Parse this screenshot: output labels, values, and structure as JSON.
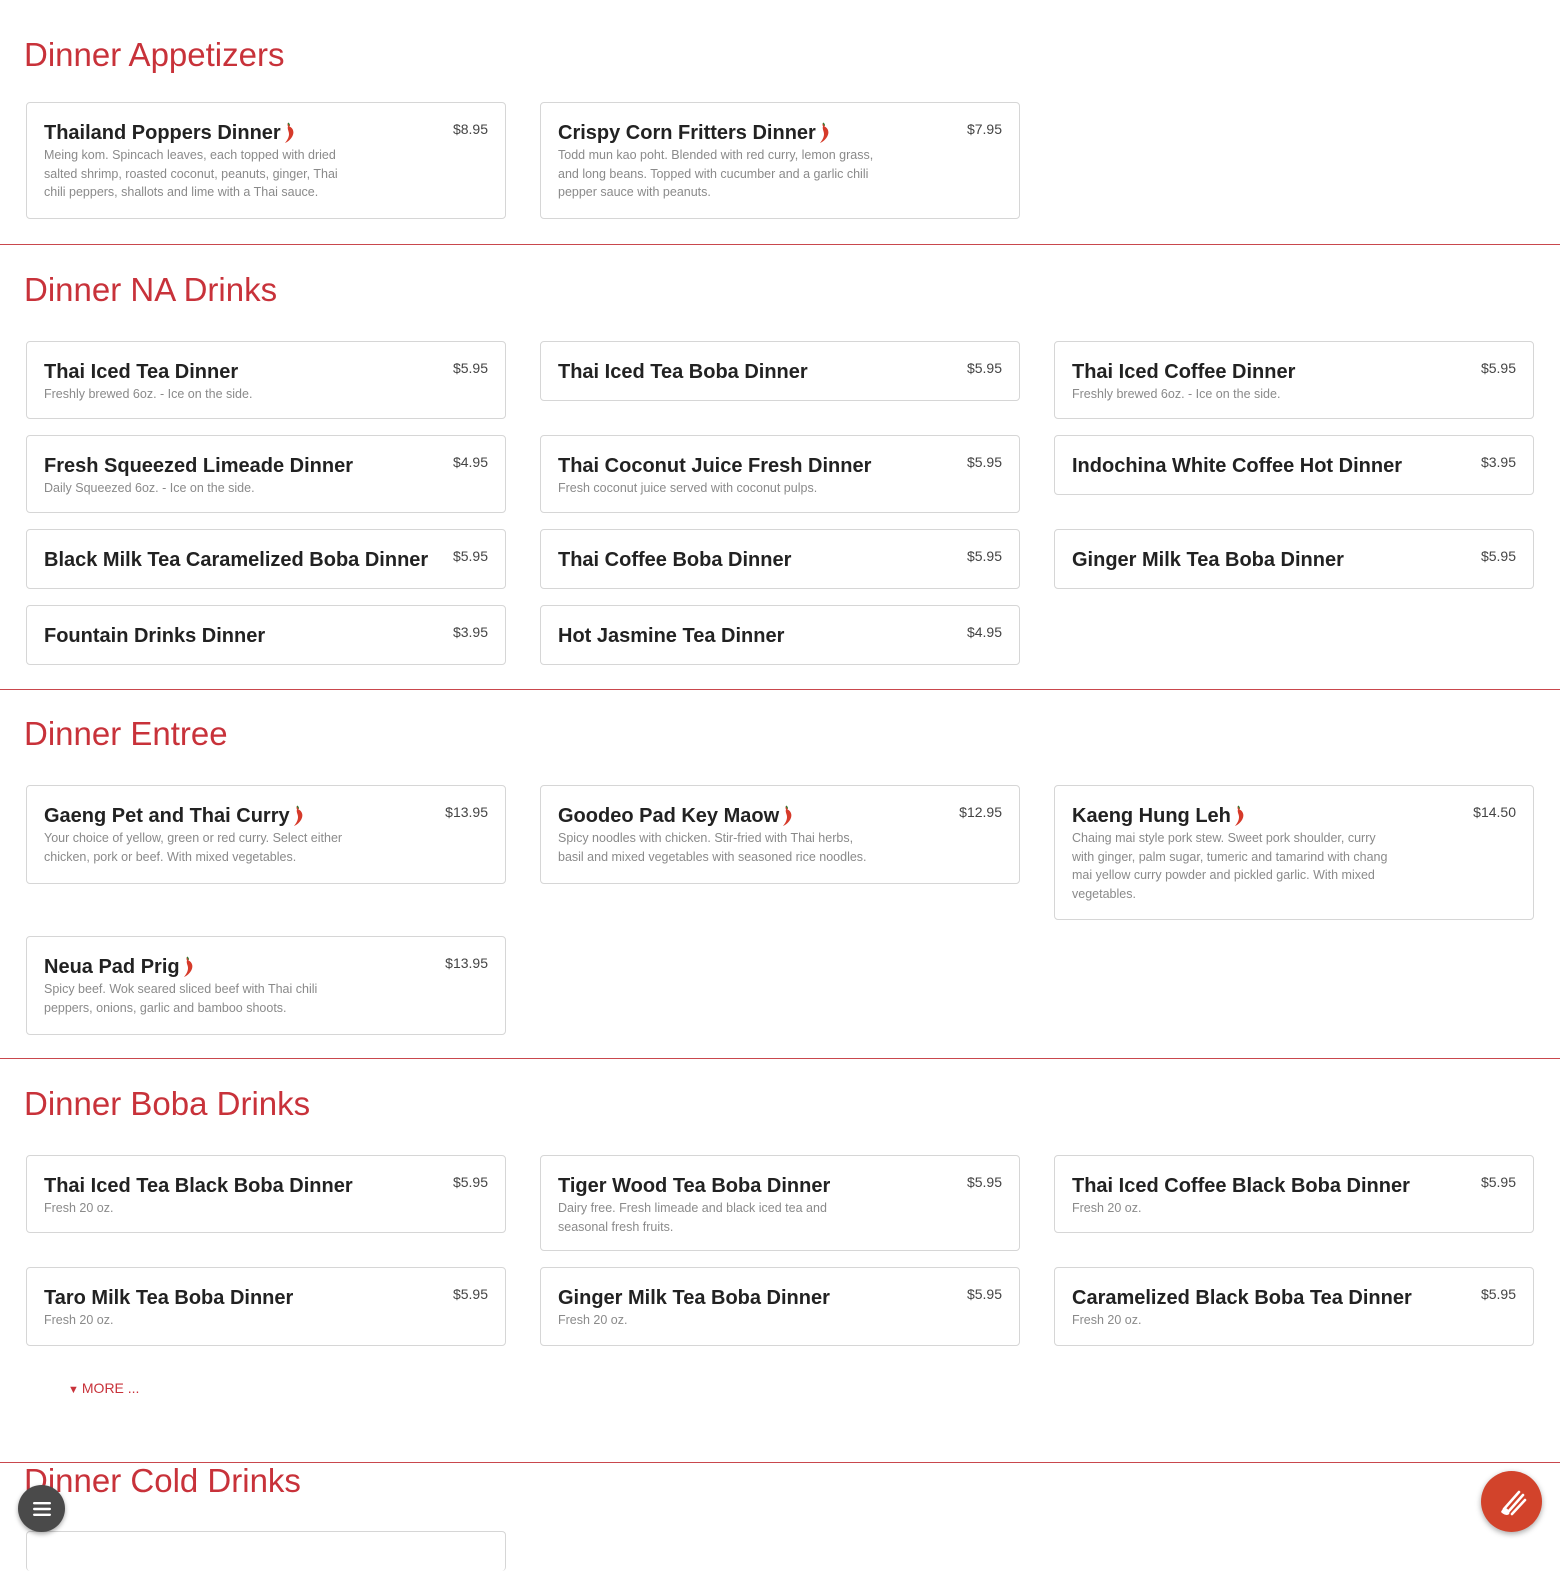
{
  "sections": [
    {
      "title": "Dinner Appetizers",
      "items": [
        {
          "name": "Thailand Poppers Dinner",
          "price": "$8.95",
          "spicy": true,
          "desc": "Meing kom. Spincach leaves, each topped with dried salted shrimp, roasted coconut, peanuts, ginger, Thai chili peppers, shallots and lime with a Thai sauce."
        },
        {
          "name": "Crispy Corn Fritters Dinner",
          "price": "$7.95",
          "spicy": true,
          "desc": "Todd mun kao poht. Blended with red curry, lemon grass, and long beans. Topped with cucumber and a garlic chili pepper sauce with peanuts."
        }
      ]
    },
    {
      "title": "Dinner NA Drinks",
      "items": [
        {
          "name": "Thai Iced Tea Dinner",
          "price": "$5.95",
          "spicy": false,
          "desc": "Freshly brewed 6oz. - Ice on the side."
        },
        {
          "name": "Thai Iced Tea Boba Dinner",
          "price": "$5.95",
          "spicy": false,
          "desc": ""
        },
        {
          "name": "Thai Iced Coffee Dinner",
          "price": "$5.95",
          "spicy": false,
          "desc": "Freshly brewed 6oz. - Ice on the side."
        },
        {
          "name": "Fresh Squeezed Limeade Dinner",
          "price": "$4.95",
          "spicy": false,
          "desc": "Daily Squeezed 6oz. - Ice on the side."
        },
        {
          "name": "Thai Coconut Juice Fresh Dinner",
          "price": "$5.95",
          "spicy": false,
          "desc": "Fresh coconut juice served with coconut pulps."
        },
        {
          "name": "Indochina White Coffee Hot Dinner",
          "price": "$3.95",
          "spicy": false,
          "desc": ""
        },
        {
          "name": "Black Milk Tea Caramelized Boba Dinner",
          "price": "$5.95",
          "spicy": false,
          "desc": ""
        },
        {
          "name": "Thai Coffee Boba Dinner",
          "price": "$5.95",
          "spicy": false,
          "desc": ""
        },
        {
          "name": "Ginger Milk Tea Boba Dinner",
          "price": "$5.95",
          "spicy": false,
          "desc": ""
        },
        {
          "name": "Fountain Drinks Dinner",
          "price": "$3.95",
          "spicy": false,
          "desc": ""
        },
        {
          "name": "Hot Jasmine Tea Dinner",
          "price": "$4.95",
          "spicy": false,
          "desc": ""
        }
      ]
    },
    {
      "title": "Dinner Entree",
      "items": [
        {
          "name": "Gaeng Pet and Thai Curry",
          "price": "$13.95",
          "spicy": true,
          "desc": "Your choice of yellow, green or red curry. Select either chicken, pork or beef. With mixed vegetables."
        },
        {
          "name": "Goodeo Pad Key Maow",
          "price": "$12.95",
          "spicy": true,
          "desc": "Spicy noodles with chicken. Stir-fried with Thai herbs, basil and mixed vegetables with seasoned rice noodles."
        },
        {
          "name": "Kaeng Hung Leh",
          "price": "$14.50",
          "spicy": true,
          "desc": "Chaing mai style pork stew. Sweet pork shoulder, curry with ginger, palm sugar, tumeric and tamarind with chang mai yellow curry powder and pickled garlic. With mixed vegetables."
        },
        {
          "name": "Neua Pad Prig",
          "price": "$13.95",
          "spicy": true,
          "desc": "Spicy beef. Wok seared sliced beef with Thai chili peppers, onions, garlic and bamboo shoots."
        }
      ]
    },
    {
      "title": "Dinner Boba Drinks",
      "items": [
        {
          "name": "Thai Iced Tea Black Boba Dinner",
          "price": "$5.95",
          "spicy": false,
          "desc": "Fresh 20 oz."
        },
        {
          "name": "Tiger Wood Tea Boba Dinner",
          "price": "$5.95",
          "spicy": false,
          "desc": "Dairy free. Fresh limeade and black iced tea and seasonal fresh fruits."
        },
        {
          "name": "Thai Iced Coffee Black Boba Dinner",
          "price": "$5.95",
          "spicy": false,
          "desc": "Fresh 20 oz."
        },
        {
          "name": "Taro Milk Tea Boba Dinner",
          "price": "$5.95",
          "spicy": false,
          "desc": "Fresh 20 oz."
        },
        {
          "name": "Ginger Milk Tea Boba Dinner",
          "price": "$5.95",
          "spicy": false,
          "desc": "Fresh 20 oz."
        },
        {
          "name": "Caramelized Black Boba Tea Dinner",
          "price": "$5.95",
          "spicy": false,
          "desc": "Fresh 20 oz."
        }
      ],
      "more_label": "MORE ..."
    },
    {
      "title": "Dinner Cold Drinks",
      "items": []
    }
  ],
  "icons": {
    "spicy": "chili-pepper-icon",
    "menu": "hamburger-menu-icon",
    "order": "order-online-icon",
    "more": "caret-down-icon"
  },
  "colors": {
    "accent": "#c8323a",
    "chili": "#d63a2a",
    "menu_fab": "#4a4a4a",
    "order_fab": "#d2432b"
  }
}
